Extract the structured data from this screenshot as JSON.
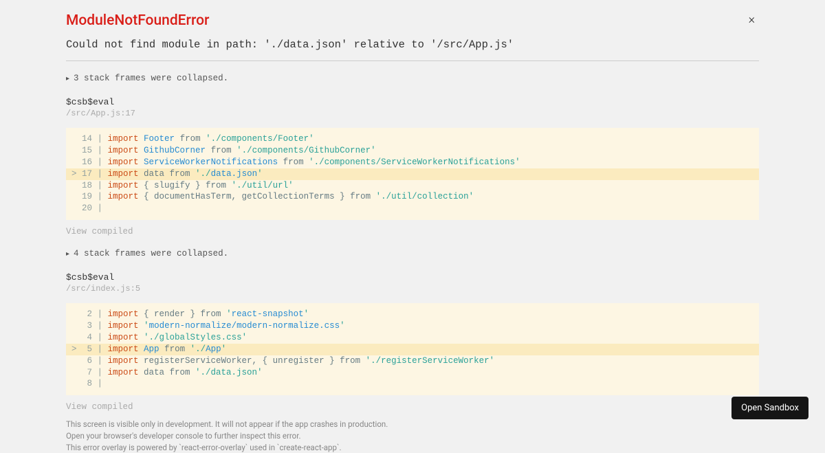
{
  "error": {
    "title": "ModuleNotFoundError",
    "message": "Could not find module in path: './data.json' relative to '/src/App.js'"
  },
  "collapsed1": "3 stack frames were collapsed.",
  "collapsed2": "4 stack frames were collapsed.",
  "frame1": {
    "name": "$csb$eval",
    "location": "/src/App.js:17",
    "lines": [
      {
        "n": "14",
        "hl": false,
        "tokens": [
          [
            "kw",
            "import"
          ],
          [
            "plain",
            " "
          ],
          [
            "idname",
            "Footer"
          ],
          [
            "plain",
            " from "
          ],
          [
            "str",
            "'./components/Footer'"
          ]
        ]
      },
      {
        "n": "15",
        "hl": false,
        "tokens": [
          [
            "kw",
            "import"
          ],
          [
            "plain",
            " "
          ],
          [
            "idname",
            "GithubCorner"
          ],
          [
            "plain",
            " from "
          ],
          [
            "str",
            "'./components/GithubCorner'"
          ]
        ]
      },
      {
        "n": "16",
        "hl": false,
        "tokens": [
          [
            "kw",
            "import"
          ],
          [
            "plain",
            " "
          ],
          [
            "idname",
            "ServiceWorkerNotifications"
          ],
          [
            "plain",
            " from "
          ],
          [
            "str",
            "'./components/ServiceWorkerNotifications'"
          ]
        ]
      },
      {
        "n": "17",
        "hl": true,
        "tokens": [
          [
            "kw",
            "import"
          ],
          [
            "plain",
            " data from "
          ],
          [
            "str",
            "'./"
          ],
          [
            "idname",
            "data.json"
          ],
          [
            "str",
            "'"
          ]
        ]
      },
      {
        "n": "18",
        "hl": false,
        "tokens": [
          [
            "kw",
            "import"
          ],
          [
            "plain",
            " { slugify } from "
          ],
          [
            "str",
            "'./util/url'"
          ]
        ]
      },
      {
        "n": "19",
        "hl": false,
        "tokens": [
          [
            "kw",
            "import"
          ],
          [
            "plain",
            " { documentHasTerm, getCollectionTerms } from "
          ],
          [
            "str",
            "'./util/collection'"
          ]
        ]
      },
      {
        "n": "20",
        "hl": false,
        "tokens": []
      }
    ]
  },
  "frame2": {
    "name": "$csb$eval",
    "location": "/src/index.js:5",
    "lines": [
      {
        "n": "2",
        "hl": false,
        "tokens": [
          [
            "kw",
            "import"
          ],
          [
            "plain",
            " { render } from "
          ],
          [
            "str",
            "'"
          ],
          [
            "idname",
            "react-snapshot"
          ],
          [
            "str",
            "'"
          ]
        ]
      },
      {
        "n": "3",
        "hl": false,
        "tokens": [
          [
            "kw",
            "import"
          ],
          [
            "plain",
            " "
          ],
          [
            "str",
            "'"
          ],
          [
            "idname",
            "modern-normalize/modern-normalize.css"
          ],
          [
            "str",
            "'"
          ]
        ]
      },
      {
        "n": "4",
        "hl": false,
        "tokens": [
          [
            "kw",
            "import"
          ],
          [
            "plain",
            " "
          ],
          [
            "str",
            "'./globalStyles.css'"
          ]
        ]
      },
      {
        "n": "5",
        "hl": true,
        "tokens": [
          [
            "kw",
            "import"
          ],
          [
            "plain",
            " "
          ],
          [
            "idname",
            "App"
          ],
          [
            "plain",
            " from "
          ],
          [
            "str",
            "'./"
          ],
          [
            "idname",
            "App"
          ],
          [
            "str",
            "'"
          ]
        ]
      },
      {
        "n": "6",
        "hl": false,
        "tokens": [
          [
            "kw",
            "import"
          ],
          [
            "plain",
            " registerServiceWorker, { unregister } from "
          ],
          [
            "str",
            "'./registerServiceWorker'"
          ]
        ]
      },
      {
        "n": "7",
        "hl": false,
        "tokens": [
          [
            "kw",
            "import"
          ],
          [
            "plain",
            " data from "
          ],
          [
            "str",
            "'./data.json'"
          ]
        ]
      },
      {
        "n": "8",
        "hl": false,
        "tokens": []
      }
    ]
  },
  "view_compiled": "View compiled",
  "footer": {
    "l1": "This screen is visible only in development. It will not appear if the app crashes in production.",
    "l2": "Open your browser's developer console to further inspect this error.",
    "l3": "This error overlay is powered by `react-error-overlay` used in `create-react-app`."
  },
  "open_sandbox": "Open Sandbox"
}
